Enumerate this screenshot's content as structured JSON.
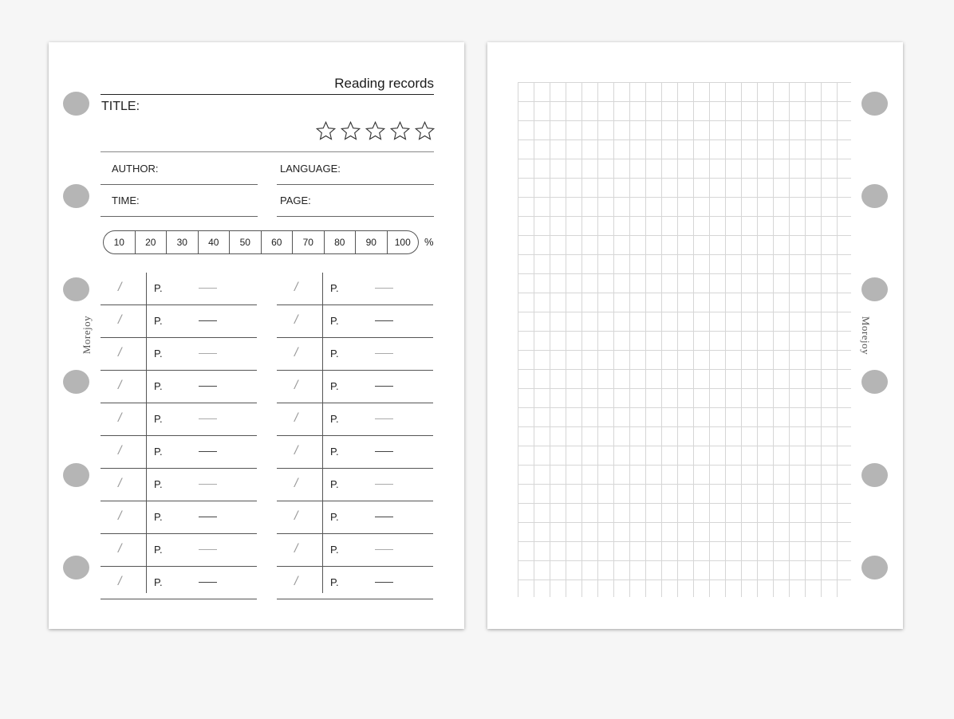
{
  "brand": "Morejoy",
  "left_page": {
    "header": "Reading records",
    "title_label": "TITLE:",
    "rating": {
      "max_stars": 5,
      "filled": 0
    },
    "fields": {
      "author": "AUTHOR:",
      "language": "LANGUAGE:",
      "time": "TIME:",
      "page": "PAGE:"
    },
    "progress": {
      "steps": [
        "10",
        "20",
        "30",
        "40",
        "50",
        "60",
        "70",
        "80",
        "90",
        "100"
      ],
      "unit": "%"
    },
    "log": {
      "rows_per_column": 10,
      "date_mark": "/",
      "page_label": "P."
    }
  },
  "right_page": {
    "type": "grid"
  }
}
